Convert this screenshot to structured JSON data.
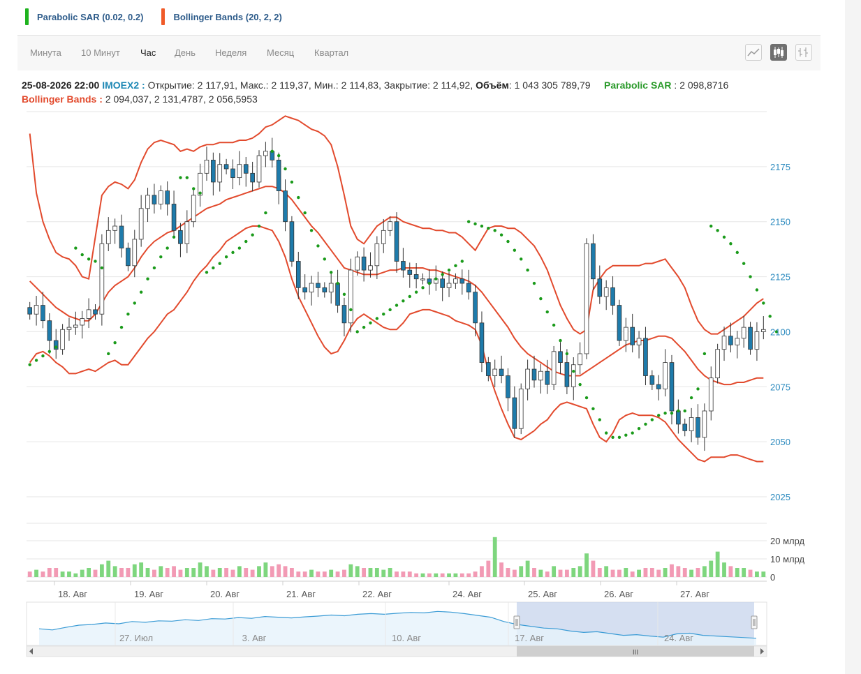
{
  "legend": [
    {
      "label": "Parabolic SAR (0.02, 0.2)",
      "color": "#1fb31f"
    },
    {
      "label": "Bollinger Bands (20, 2, 2)",
      "color": "#f05a28"
    }
  ],
  "tabs": [
    "Минута",
    "10 Минут",
    "Час",
    "День",
    "Неделя",
    "Месяц",
    "Квартал"
  ],
  "active_tab": "Час",
  "info": {
    "datetime": "25-08-2026 22:00",
    "ticker": "IMOEX2",
    "open_label": "Открытие:",
    "open": "2 117,91",
    "high_label": "Макс.:",
    "high": "2 119,37",
    "low_label": "Мин.:",
    "low": "2 114,83",
    "close_label": "Закрытие:",
    "close": "2 114,92",
    "volume_label": "Объём",
    "volume": "1 043 305 789,79",
    "sar_label": "Parabolic SAR",
    "sar_value": "2 098,8716",
    "bb_label": "Bollinger Bands",
    "bb_values": "2 094,037, 2 131,4787, 2 056,5953"
  },
  "colors": {
    "up_candle": "#ffffff",
    "down_candle": "#1e7bab",
    "bollinger": "#e24a2d",
    "sar": "#1a9a1a",
    "vol_up": "#7ed67e",
    "vol_down": "#f29ab4",
    "axis_text": "#2d8bbf",
    "navigator_line": "#3a9bd5"
  },
  "chart_data": {
    "type": "candlestick",
    "x_axis_labels": [
      "18. Авг",
      "19. Авг",
      "20. Авг",
      "21. Авг",
      "22. Авг",
      "24. Авг",
      "25. Авг",
      "26. Авг",
      "27. Авг"
    ],
    "y_axis": {
      "ticks": [
        2025,
        2050,
        2075,
        2100,
        2125,
        2150,
        2175
      ],
      "range": [
        2025,
        2200
      ]
    },
    "volume_axis": {
      "ticks": [
        "20 млрд",
        "10 млрд",
        "0"
      ],
      "range": [
        0,
        25
      ]
    },
    "navigator_labels": [
      "27. Июл",
      "3. Авг",
      "10. Авг",
      "17. Авг",
      "24. Авг"
    ],
    "close": [
      2108,
      2112,
      2105,
      2096,
      2092,
      2101,
      2102,
      2103,
      2106,
      2110,
      2108,
      2140,
      2146,
      2148,
      2138,
      2130,
      2142,
      2156,
      2162,
      2158,
      2164,
      2158,
      2146,
      2140,
      2150,
      2162,
      2172,
      2178,
      2168,
      2176,
      2174,
      2170,
      2176,
      2172,
      2168,
      2180,
      2182,
      2178,
      2164,
      2150,
      2132,
      2120,
      2118,
      2122,
      2120,
      2118,
      2122,
      2112,
      2104,
      2128,
      2134,
      2128,
      2130,
      2140,
      2146,
      2150,
      2132,
      2128,
      2126,
      2124,
      2124,
      2122,
      2124,
      2120,
      2122,
      2124,
      2122,
      2118,
      2104,
      2086,
      2080,
      2083,
      2080,
      2070,
      2056,
      2074,
      2083,
      2078,
      2082,
      2076,
      2091,
      2086,
      2075,
      2085,
      2090,
      2140,
      2124,
      2116,
      2120,
      2112,
      2096,
      2102,
      2094,
      2097,
      2080,
      2076,
      2074,
      2086,
      2064,
      2058,
      2055,
      2061,
      2052,
      2064,
      2079,
      2092,
      2098,
      2094,
      2097,
      2102,
      2092,
      2100,
      2101
    ],
    "volume": [
      3,
      4,
      3,
      5,
      5,
      3,
      3,
      2,
      4,
      5,
      4,
      7,
      9,
      6,
      5,
      5,
      7,
      8,
      5,
      4,
      6,
      5,
      6,
      4,
      5,
      5,
      8,
      6,
      4,
      5,
      5,
      4,
      6,
      5,
      4,
      6,
      8,
      6,
      7,
      6,
      5,
      3,
      3,
      4,
      3,
      3,
      4,
      3,
      4,
      7,
      6,
      5,
      5,
      5,
      4,
      5,
      3,
      3,
      3,
      2,
      2,
      2,
      2,
      2,
      2,
      2,
      2,
      2,
      3,
      6,
      9,
      22,
      8,
      5,
      4,
      6,
      9,
      5,
      4,
      3,
      6,
      4,
      4,
      5,
      6,
      13,
      9,
      5,
      6,
      4,
      4,
      5,
      3,
      4,
      5,
      5,
      4,
      5,
      7,
      6,
      5,
      4,
      5,
      6,
      9,
      14,
      8,
      6,
      5,
      5,
      4,
      3,
      3
    ],
    "bollinger_upper": [
      2190,
      2163,
      2150,
      2142,
      2136,
      2134,
      2133,
      2130,
      2125,
      2124,
      2143,
      2162,
      2166,
      2168,
      2167,
      2165,
      2169,
      2177,
      2183,
      2186,
      2187,
      2186,
      2185,
      2182,
      2183,
      2182,
      2184,
      2185,
      2185,
      2186,
      2186,
      2186,
      2187,
      2187,
      2188,
      2190,
      2193,
      2194,
      2196,
      2198,
      2197,
      2196,
      2194,
      2192,
      2191,
      2189,
      2185,
      2175,
      2162,
      2148,
      2142,
      2140,
      2144,
      2148,
      2150,
      2152,
      2152,
      2150,
      2149,
      2148,
      2147,
      2147,
      2146,
      2146,
      2145,
      2145,
      2143,
      2140,
      2137,
      2142,
      2147,
      2148,
      2148,
      2147,
      2147,
      2145,
      2142,
      2139,
      2134,
      2128,
      2120,
      2112,
      2106,
      2101,
      2099,
      2101,
      2119,
      2124,
      2128,
      2130,
      2130,
      2130,
      2130,
      2130,
      2131,
      2131,
      2132,
      2133,
      2129,
      2125,
      2120,
      2112,
      2105,
      2101,
      2099,
      2099,
      2101,
      2103,
      2105,
      2107,
      2110,
      2113,
      2115
    ],
    "bollinger_middle": [
      2123,
      2120,
      2117,
      2114,
      2111,
      2109,
      2107,
      2106,
      2105,
      2105,
      2108,
      2113,
      2118,
      2121,
      2123,
      2125,
      2129,
      2134,
      2138,
      2141,
      2143,
      2145,
      2146,
      2148,
      2150,
      2152,
      2154,
      2156,
      2157,
      2158,
      2160,
      2161,
      2162,
      2163,
      2164,
      2165,
      2166,
      2166,
      2165,
      2163,
      2160,
      2156,
      2152,
      2148,
      2145,
      2141,
      2137,
      2133,
      2129,
      2128,
      2127,
      2126,
      2126,
      2126,
      2127,
      2128,
      2128,
      2129,
      2129,
      2129,
      2129,
      2128,
      2128,
      2127,
      2126,
      2125,
      2124,
      2123,
      2121,
      2118,
      2114,
      2110,
      2106,
      2102,
      2097,
      2093,
      2090,
      2088,
      2086,
      2084,
      2082,
      2081,
      2080,
      2080,
      2080,
      2082,
      2084,
      2086,
      2088,
      2090,
      2092,
      2094,
      2095,
      2096,
      2096,
      2097,
      2098,
      2098,
      2097,
      2094,
      2091,
      2087,
      2083,
      2080,
      2078,
      2077,
      2076,
      2076,
      2077,
      2077,
      2078,
      2079,
      2079
    ],
    "bollinger_lower": [
      2086,
      2090,
      2091,
      2089,
      2086,
      2084,
      2081,
      2081,
      2082,
      2083,
      2082,
      2084,
      2086,
      2087,
      2085,
      2085,
      2089,
      2093,
      2097,
      2100,
      2104,
      2108,
      2110,
      2114,
      2118,
      2123,
      2127,
      2130,
      2134,
      2137,
      2141,
      2143,
      2145,
      2147,
      2148,
      2148,
      2147,
      2146,
      2141,
      2134,
      2124,
      2116,
      2110,
      2104,
      2098,
      2093,
      2090,
      2091,
      2096,
      2102,
      2106,
      2108,
      2106,
      2104,
      2102,
      2101,
      2101,
      2104,
      2108,
      2109,
      2110,
      2110,
      2109,
      2108,
      2107,
      2105,
      2104,
      2103,
      2101,
      2094,
      2082,
      2073,
      2065,
      2058,
      2052,
      2051,
      2053,
      2055,
      2058,
      2060,
      2064,
      2067,
      2068,
      2067,
      2066,
      2065,
      2058,
      2052,
      2050,
      2054,
      2060,
      2062,
      2063,
      2062,
      2062,
      2062,
      2061,
      2059,
      2055,
      2051,
      2048,
      2045,
      2042,
      2041,
      2043,
      2043,
      2043,
      2044,
      2044,
      2043,
      2042,
      2041,
      2041
    ],
    "sar": [
      2085,
      2087,
      2089,
      2091,
      2093,
      null,
      null,
      2138,
      2135,
      2133,
      2132,
      2129,
      2090,
      2095,
      2102,
      2108,
      2113,
      2118,
      2124,
      2129,
      2134,
      2138,
      2143,
      2170,
      2170,
      2165,
      2163,
      2127,
      2129,
      2131,
      2134,
      2136,
      2138,
      2141,
      2144,
      2148,
      2154,
      2182,
      2180,
      2174,
      2168,
      2161,
      2154,
      2146,
      2139,
      2133,
      2127,
      2122,
      2117,
      2110,
      2100,
      2102,
      2104,
      2106,
      2108,
      2110,
      2112,
      2114,
      2116,
      2118,
      2120,
      2122,
      2124,
      2126,
      2128,
      2130,
      2132,
      2150,
      2149,
      2148,
      2147,
      2146,
      2144,
      2141,
      2137,
      2133,
      2128,
      2122,
      2115,
      2109,
      2103,
      2096,
      2090,
      2082,
      2076,
      2070,
      2065,
      2060,
      2054,
      2052,
      2052,
      2053,
      2054,
      2056,
      2058,
      2060,
      2062,
      2063,
      2063,
      2064,
      2064,
      2070,
      2074,
      2090,
      2148,
      2146,
      2143,
      2140,
      2136,
      2131,
      2125,
      2119,
      2113,
      2107,
      2100
    ],
    "navigator_series": [
      2108,
      2105,
      2112,
      2118,
      2120,
      2124,
      2122,
      2128,
      2126,
      2130,
      2129,
      2133,
      2131,
      2136,
      2135,
      2139,
      2137,
      2142,
      2140,
      2138,
      2141,
      2143,
      2146,
      2144,
      2148,
      2150,
      2148,
      2151,
      2153,
      2152,
      2156,
      2154,
      2150,
      2145,
      2140,
      2128,
      2120,
      2115,
      2110,
      2108,
      2102,
      2098,
      2100,
      2095,
      2090,
      2092,
      2088,
      2085,
      2094,
      2096,
      2090,
      2088,
      2086,
      2084,
      2082
    ]
  }
}
